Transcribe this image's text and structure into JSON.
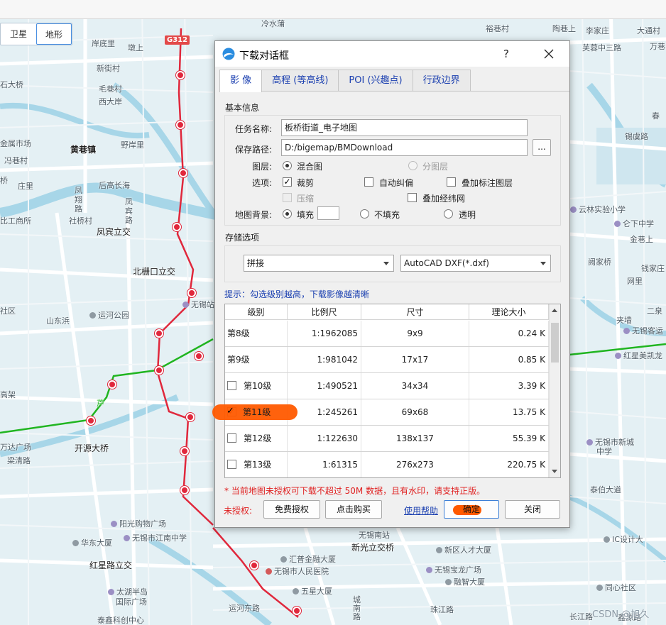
{
  "map": {
    "toggle": {
      "satellite": "卫星",
      "terrain": "地形"
    },
    "road_shields": [
      "G312"
    ],
    "labels": [
      {
        "text": "冷水蒲",
        "cls": ""
      },
      {
        "text": "裕巷村",
        "cls": ""
      },
      {
        "text": "陶巷上",
        "cls": ""
      },
      {
        "text": "李家庄",
        "cls": ""
      },
      {
        "text": "大通村",
        "cls": ""
      },
      {
        "text": "岸底里",
        "cls": ""
      },
      {
        "text": "墩上",
        "cls": ""
      },
      {
        "text": "芙蓉中三路",
        "cls": ""
      },
      {
        "text": "万巷",
        "cls": ""
      },
      {
        "text": "新街村",
        "cls": ""
      },
      {
        "text": "石大桥",
        "cls": ""
      },
      {
        "text": "毛巷村",
        "cls": ""
      },
      {
        "text": "西大岸",
        "cls": ""
      },
      {
        "text": "春",
        "cls": ""
      },
      {
        "text": "金属市场",
        "cls": ""
      },
      {
        "text": "锡虞路",
        "cls": ""
      },
      {
        "text": "黄巷镇",
        "cls": "bold"
      },
      {
        "text": "野岸里",
        "cls": ""
      },
      {
        "text": "冯巷村",
        "cls": ""
      },
      {
        "text": "桥",
        "cls": ""
      },
      {
        "text": "庄里",
        "cls": ""
      },
      {
        "text": "后高长海",
        "cls": ""
      },
      {
        "text": "凤翔路",
        "cls": ""
      },
      {
        "text": "凤宾路",
        "cls": ""
      },
      {
        "text": "云林实验小学",
        "cls": "poi"
      },
      {
        "text": "仑下中学",
        "cls": "poi"
      },
      {
        "text": "比工商所",
        "cls": ""
      },
      {
        "text": "社桥村",
        "cls": ""
      },
      {
        "text": "凤宾立交",
        "cls": "bold"
      },
      {
        "text": "金巷上",
        "cls": ""
      },
      {
        "text": "北栅口立交",
        "cls": "bold"
      },
      {
        "text": "阙家桥",
        "cls": ""
      },
      {
        "text": "钱家庄",
        "cls": ""
      },
      {
        "text": "网里",
        "cls": ""
      },
      {
        "text": "社区",
        "cls": ""
      },
      {
        "text": "运河公园",
        "cls": "poi-grey"
      },
      {
        "text": "无锡站",
        "cls": "poi"
      },
      {
        "text": "二泉",
        "cls": ""
      },
      {
        "text": "山东浜",
        "cls": ""
      },
      {
        "text": "夹墙",
        "cls": ""
      },
      {
        "text": "无锡客运",
        "cls": "poi"
      },
      {
        "text": "红星美凯龙",
        "cls": "poi"
      },
      {
        "text": "高架",
        "cls": ""
      },
      {
        "text": "芦",
        "cls": ""
      },
      {
        "text": "万达广场",
        "cls": ""
      },
      {
        "text": "开源大桥",
        "cls": "bold"
      },
      {
        "text": "梁清路",
        "cls": ""
      },
      {
        "text": "无锡市新城",
        "cls": "poi"
      },
      {
        "text": "中学",
        "cls": ""
      },
      {
        "text": "泰伯大道",
        "cls": ""
      },
      {
        "text": "阳光购物广场",
        "cls": "poi"
      },
      {
        "text": "无锡南站",
        "cls": ""
      },
      {
        "text": "华东大厦",
        "cls": "poi-grey"
      },
      {
        "text": "无锡市江南中学",
        "cls": "poi"
      },
      {
        "text": "新光立交桥",
        "cls": "bold"
      },
      {
        "text": "新区人才大厦",
        "cls": "poi-grey"
      },
      {
        "text": "IC设计大",
        "cls": "poi-grey"
      },
      {
        "text": "红星路立交",
        "cls": "bold"
      },
      {
        "text": "汇普金融大厦",
        "cls": "poi-grey"
      },
      {
        "text": "无锡市人民医院",
        "cls": "poi-red"
      },
      {
        "text": "无锡宝龙广场",
        "cls": "poi"
      },
      {
        "text": "融智大厦",
        "cls": "poi-grey"
      },
      {
        "text": "太湖半岛",
        "cls": "poi"
      },
      {
        "text": "国际广场",
        "cls": ""
      },
      {
        "text": "五星大厦",
        "cls": "poi-grey"
      },
      {
        "text": "同心社区",
        "cls": "poi-grey"
      },
      {
        "text": "运河东路",
        "cls": ""
      },
      {
        "text": "城南路",
        "cls": ""
      },
      {
        "text": "珠江路",
        "cls": ""
      },
      {
        "text": "长江路",
        "cls": ""
      },
      {
        "text": "鑫源路",
        "cls": ""
      },
      {
        "text": "泰鑫科创中心",
        "cls": ""
      }
    ]
  },
  "dialog": {
    "title": "下载对话框",
    "help": "?",
    "tabs": [
      {
        "label": "影 像",
        "active": true
      },
      {
        "label": "高程 (等高线)",
        "active": false
      },
      {
        "label": "POI (兴趣点)",
        "active": false
      },
      {
        "label": "行政边界",
        "active": false
      }
    ],
    "basic": {
      "section_title": "基本信息",
      "task_name_label": "任务名称:",
      "task_name_value": "板桥街道_电子地图",
      "save_path_label": "保存路径:",
      "save_path_value": "D:/bigemap/BMDownload",
      "browse_label": "...",
      "layer_label": "图层:",
      "layer_merged": "混合图",
      "layer_split": "分图层",
      "options_label": "选项:",
      "opt_clip": "裁剪",
      "opt_autocorrect": "自动纠偏",
      "opt_overlay_labels": "叠加标注图层",
      "opt_compress": "压缩",
      "opt_overlay_grid": "叠加经纬网",
      "bg_label": "地图背景:",
      "bg_fill": "填充",
      "bg_nofill": "不填充",
      "bg_transparent": "透明"
    },
    "storage": {
      "section_title": "存储选项",
      "mode_value": "拼接",
      "format_value": "AutoCAD DXF(*.dxf)"
    },
    "hint": "提示：勾选级别越高，下载影像越清晰",
    "table": {
      "headers": [
        "级别",
        "比例尺",
        "尺寸",
        "理论大小"
      ],
      "rows": [
        {
          "level": "第8级",
          "scale": "1:1962085",
          "size": "9x9",
          "est": "0.24 K",
          "has_check": false,
          "checked": false
        },
        {
          "level": "第9级",
          "scale": "1:981042",
          "size": "17x17",
          "est": "0.85 K",
          "has_check": false,
          "checked": false
        },
        {
          "level": "第10级",
          "scale": "1:490521",
          "size": "34x34",
          "est": "3.39 K",
          "has_check": true,
          "checked": false
        },
        {
          "level": "第11级",
          "scale": "1:245261",
          "size": "69x68",
          "est": "13.75 K",
          "has_check": true,
          "checked": true
        },
        {
          "level": "第12级",
          "scale": "1:122630",
          "size": "138x137",
          "est": "55.39 K",
          "has_check": true,
          "checked": false
        },
        {
          "level": "第13级",
          "scale": "1:61315",
          "size": "276x273",
          "est": "220.75 K",
          "has_check": true,
          "checked": false
        }
      ]
    },
    "warning": "* 当前地图未授权可下载不超过 50M 数据，且有水印，请支持正版。",
    "footer": {
      "unauth_label": "未授权:",
      "free_license": "免费授权",
      "buy": "点击购买",
      "help_link": "使用帮助",
      "ok": "确定",
      "close": "关闭"
    }
  },
  "watermark": "CSDN @旭久",
  "colors": {
    "metro": "#e0283c",
    "green_line": "#20b520",
    "river": "#9fd3e6",
    "orange_mark": "#ff5a00"
  }
}
